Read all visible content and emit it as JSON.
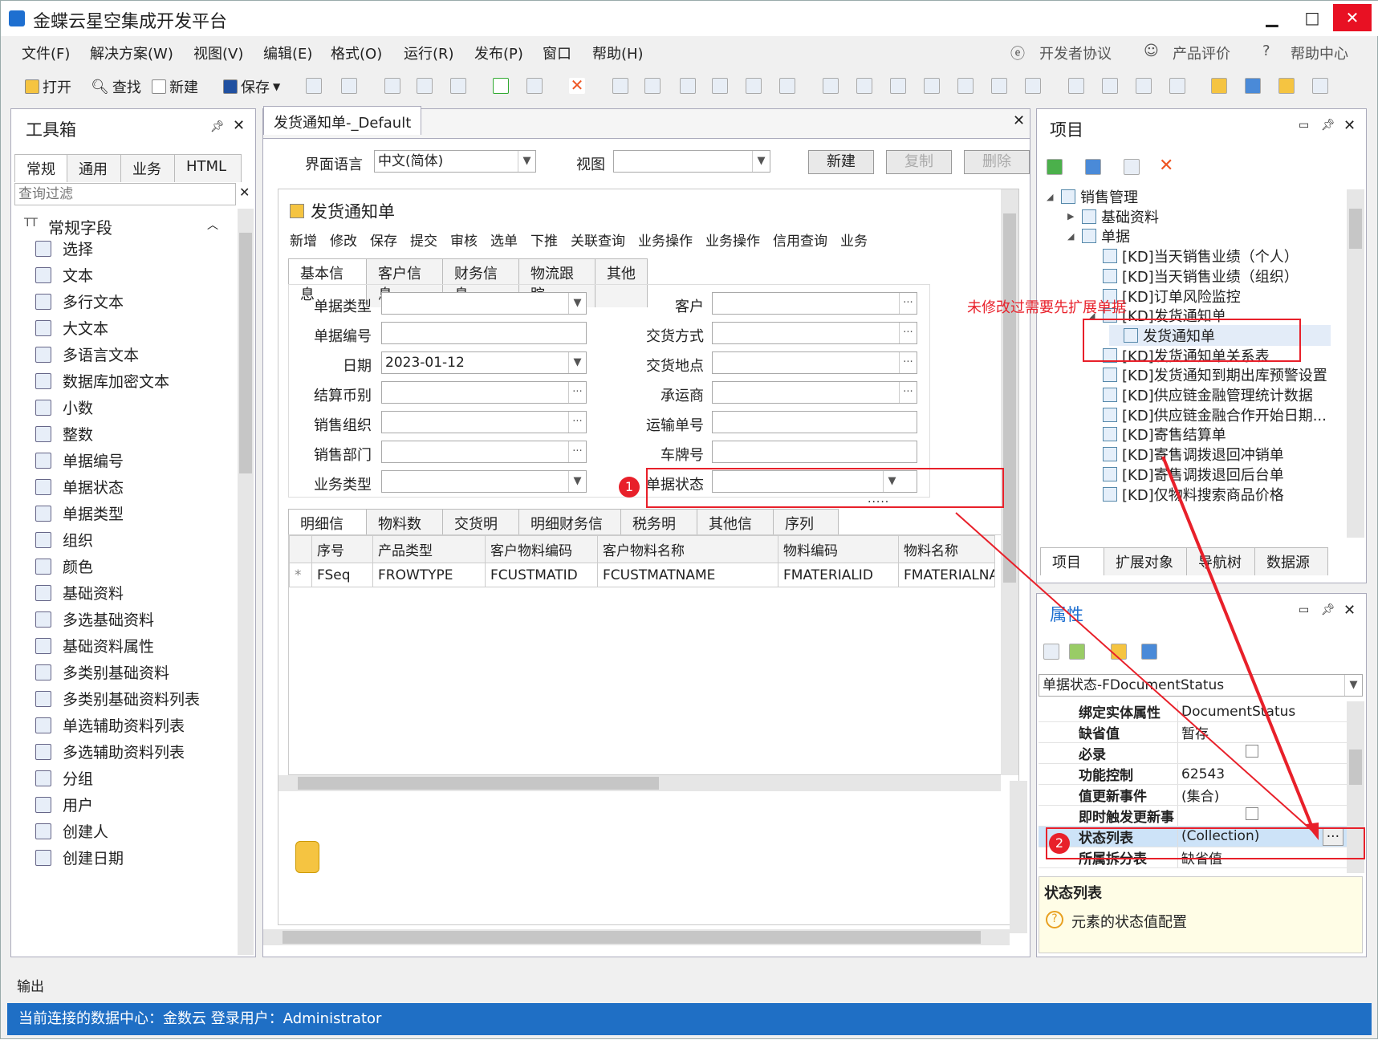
{
  "app": {
    "title": "金蝶云星空集成开发平台",
    "min": "▁",
    "max": "□",
    "close": "✕"
  },
  "menus": [
    "文件(F)",
    "解决方案(W)",
    "视图(V)",
    "编辑(E)",
    "格式(O)",
    "运行(R)",
    "发布(P)",
    "窗口",
    "帮助(H)"
  ],
  "rightlinks": {
    "dev": "开发者协议",
    "eval": "产品评价",
    "help": "帮助中心"
  },
  "toolbar": {
    "open": "打开",
    "find": "查找",
    "new": "新建",
    "save": "保存"
  },
  "toolbox": {
    "title": "工具箱",
    "tabs": [
      "常规",
      "通用",
      "业务",
      "HTML"
    ],
    "filter_placeholder": "查询过滤",
    "section": "常规字段",
    "items": [
      "选择",
      "文本",
      "多行文本",
      "大文本",
      "多语言文本",
      "数据库加密文本",
      "小数",
      "整数",
      "单据编号",
      "单据状态",
      "单据类型",
      "组织",
      "颜色",
      "基础资料",
      "多选基础资料",
      "基础资料属性",
      "多类别基础资料",
      "多类别基础资料列表",
      "单选辅助资料列表",
      "多选辅助资料列表",
      "分组",
      "用户",
      "创建人",
      "创建日期"
    ]
  },
  "doc": {
    "tab": "发货通知单-_Default",
    "lang_label": "界面语言",
    "lang_value": "中文(简体)",
    "view_label": "视图",
    "btn_new": "新建",
    "btn_copy": "复制",
    "btn_delete": "删除",
    "form_title": "发货通知单",
    "form_toolbar": [
      "新增",
      "修改",
      "保存",
      "提交",
      "审核",
      "选单",
      "下推",
      "关联查询",
      "业务操作",
      "业务操作",
      "信用查询",
      "业务"
    ],
    "head_tabs": [
      "基本信息",
      "客户信息",
      "财务信息",
      "物流跟踪",
      "其他"
    ],
    "left_fields": [
      {
        "label": "单据类型",
        "value": ""
      },
      {
        "label": "单据编号",
        "value": ""
      },
      {
        "label": "日期",
        "value": "2023-01-12"
      },
      {
        "label": "结算币别",
        "value": ""
      },
      {
        "label": "销售组织",
        "value": ""
      },
      {
        "label": "销售部门",
        "value": ""
      },
      {
        "label": "业务类型",
        "value": ""
      }
    ],
    "right_fields": [
      {
        "label": "客户"
      },
      {
        "label": "交货方式"
      },
      {
        "label": "交货地点"
      },
      {
        "label": "承运商"
      },
      {
        "label": "运输单号"
      },
      {
        "label": "车牌号"
      },
      {
        "label": "单据状态"
      }
    ],
    "entry_tabs": [
      "明细信息",
      "物料数据",
      "交货明细",
      "明细财务信息",
      "税务明细",
      "其他信息",
      "序列号"
    ],
    "grid_headers": [
      "序号",
      "产品类型",
      "客户物料编码",
      "客户物料名称",
      "物料编码",
      "物料名称"
    ],
    "grid_row": [
      "FSeq",
      "FROWTYPE",
      "FCUSTMATID",
      "FCUSTMATNAME",
      "FMATERIALID",
      "FMATERIALNA"
    ],
    "dots": "....."
  },
  "project": {
    "title": "项目",
    "tree": [
      {
        "t": "销售管理",
        "lv": 0,
        "exp": "◢"
      },
      {
        "t": "基础资料",
        "lv": 1,
        "exp": "▶"
      },
      {
        "t": "单据",
        "lv": 1,
        "exp": "◢"
      },
      {
        "t": "[KD]当天销售业绩（个人）",
        "lv": 2
      },
      {
        "t": "[KD]当天销售业绩（组织）",
        "lv": 2
      },
      {
        "t": "[KD]订单风险监控",
        "lv": 2
      },
      {
        "t": "[KD]发货通知单",
        "lv": 2,
        "exp": "◢"
      },
      {
        "t": "发货通知单",
        "lv": 3,
        "sel": true
      },
      {
        "t": "[KD]发货通知单关系表",
        "lv": 2
      },
      {
        "t": "[KD]发货通知到期出库预警设置",
        "lv": 2
      },
      {
        "t": "[KD]供应链金融管理统计数据",
        "lv": 2
      },
      {
        "t": "[KD]供应链金融合作开始日期...",
        "lv": 2
      },
      {
        "t": "[KD]寄售结算单",
        "lv": 2
      },
      {
        "t": "[KD]寄售调拨退回冲销单",
        "lv": 2
      },
      {
        "t": "[KD]寄售调拨退回后台单",
        "lv": 2
      },
      {
        "t": "[KD]仅物料搜索商品价格",
        "lv": 2
      }
    ],
    "bottom_tabs": [
      "项目",
      "扩展对象",
      "导航树",
      "数据源"
    ]
  },
  "annotation": "未修改过需要先扩展单据",
  "props": {
    "title": "属性",
    "selector": "单据状态-FDocumentStatus",
    "rows": [
      {
        "k": "绑定实体属性",
        "v": "DocumentStatus"
      },
      {
        "k": "缺省值",
        "v": "暂存"
      },
      {
        "k": "必录",
        "v": "",
        "cb": true
      },
      {
        "k": "功能控制",
        "v": "62543"
      },
      {
        "k": "值更新事件",
        "v": "(集合)"
      },
      {
        "k": "即时触发更新事",
        "v": "",
        "cb": true
      },
      {
        "k": "状态列表",
        "v": "(Collection)",
        "sel": true
      },
      {
        "k": "所属拆分表",
        "v": "缺省值"
      }
    ],
    "desc_title": "状态列表",
    "desc": "元素的状态值配置"
  },
  "badges": [
    "1",
    "2"
  ],
  "output": "输出",
  "status": "当前连接的数据中心：金数云  登录用户：Administrator"
}
